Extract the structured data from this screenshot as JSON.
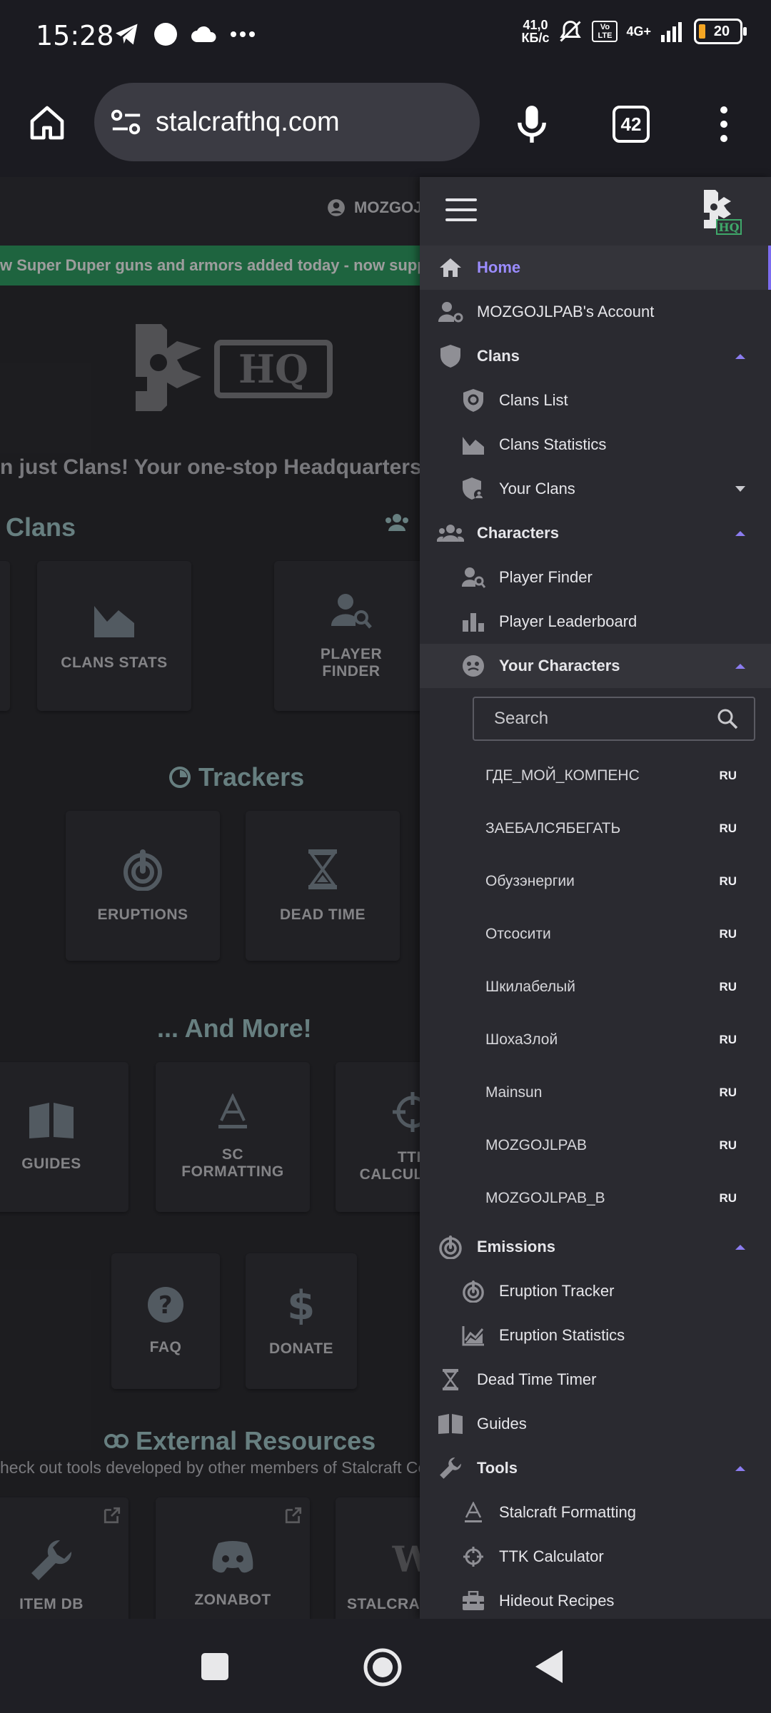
{
  "status_bar": {
    "time": "15:28",
    "speed_value": "41,0",
    "speed_unit": "КБ/с",
    "volte_label": "Vo LTE",
    "network_label": "4G+",
    "battery_level": "20"
  },
  "browser": {
    "url": "stalcrafthq.com",
    "tab_count": "42"
  },
  "page": {
    "account_name": "MOZGOJLPAB",
    "banner_text": "w Super Duper guns and armors added today - now supported",
    "logo_text": "HQ",
    "tagline": "n just Clans! Your one-stop Headquarters for",
    "clans_title": "Clans",
    "clans_cards": [
      "CLANS STATS",
      "PLAYER FINDER"
    ],
    "trackers_title": "Trackers",
    "trackers_cards": [
      "ERUPTIONS",
      "DEAD TIME"
    ],
    "more_title": "... And More!",
    "more_cards": [
      "GUIDES",
      "SC FORMATTING",
      "TTK CALCULATOR"
    ],
    "extra_cards": [
      "FAQ",
      "DONATE"
    ],
    "external_title": "External Resources",
    "external_subtitle": "heck out tools developed by other members of Stalcraft Com",
    "external_cards": [
      "ITEM DB",
      "ZONABOT",
      "STALCRAFT WIKI"
    ]
  },
  "drawer": {
    "logo_text": "HQ",
    "items": {
      "home": "Home",
      "account": "MOZGOJLPAB's Account",
      "clans": "Clans",
      "clans_list": "Clans List",
      "clans_statistics": "Clans Statistics",
      "your_clans": "Your Clans",
      "characters": "Characters",
      "player_finder": "Player Finder",
      "player_leaderboard": "Player Leaderboard",
      "your_characters": "Your Characters",
      "emissions": "Emissions",
      "eruption_tracker": "Eruption Tracker",
      "eruption_statistics": "Eruption Statistics",
      "dead_time_timer": "Dead Time Timer",
      "guides": "Guides",
      "tools": "Tools",
      "stalcraft_formatting": "Stalcraft Formatting",
      "ttk_calculator": "TTK Calculator",
      "hideout_recipes": "Hideout Recipes"
    },
    "search_placeholder": "Search",
    "characters": [
      {
        "name": "ГДЕ_МОЙ_КОМПЕНС",
        "region": "RU"
      },
      {
        "name": "ЗАЕБАЛСЯБЕГАТЬ",
        "region": "RU"
      },
      {
        "name": "Обузэнергии",
        "region": "RU"
      },
      {
        "name": "Отсосити",
        "region": "RU"
      },
      {
        "name": "Шкилабелый",
        "region": "RU"
      },
      {
        "name": "ШохаЗлой",
        "region": "RU"
      },
      {
        "name": "Mainsun",
        "region": "RU"
      },
      {
        "name": "MOZGOJLPAB",
        "region": "RU"
      },
      {
        "name": "MOZGOJLPAB_B",
        "region": "RU"
      }
    ]
  },
  "colors": {
    "accent": "#7c6cf0",
    "banner": "#2f9a62",
    "section_title": "#9fc3c5",
    "drawer_bg": "#2a2a30"
  }
}
